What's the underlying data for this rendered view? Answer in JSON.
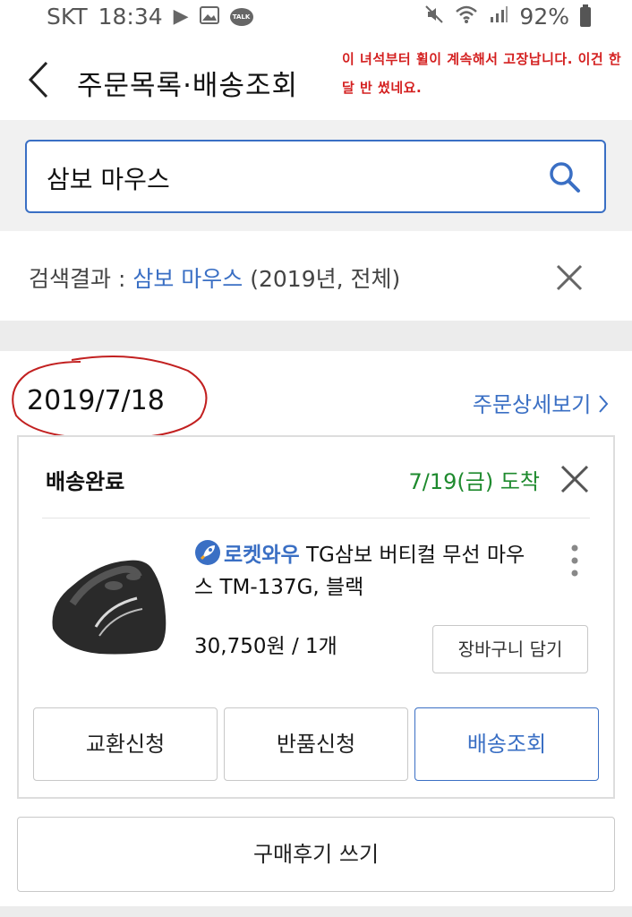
{
  "status_bar": {
    "carrier": "SKT",
    "time": "18:34",
    "battery": "92%",
    "icons": [
      "play-icon",
      "image-icon",
      "talk-icon",
      "mute-icon",
      "wifi-icon",
      "signal-icon",
      "battery-icon"
    ],
    "talk_label": "TALK"
  },
  "header": {
    "title": "주문목록·배송조회",
    "annotation": "이 녀석부터 휠이 계속해서 고장납니다. 이건 한달 반 썼네요."
  },
  "search": {
    "value": "삼보 마우스"
  },
  "result": {
    "prefix": "검색결과 : ",
    "keyword": "삼보 마우스",
    "suffix": " (2019년, 전체)"
  },
  "order": {
    "date": "2019/7/18",
    "detail_link": "주문상세보기",
    "status": "배송완료",
    "arrival": "7/19(금) 도착",
    "product": {
      "badge": "로켓와우",
      "name": " TG삼보 버티컬 무선 마우스 TM-137G, 블랙",
      "price": "30,750원 / 1개",
      "cart_button": "장바구니 담기"
    },
    "buttons": {
      "exchange": "교환신청",
      "return": "반품신청",
      "tracking": "배송조회"
    },
    "review_button": "구매후기 쓰기"
  },
  "colors": {
    "accent": "#3a6fc4",
    "arrival": "#1e8a2e",
    "annotation": "#d42020"
  }
}
